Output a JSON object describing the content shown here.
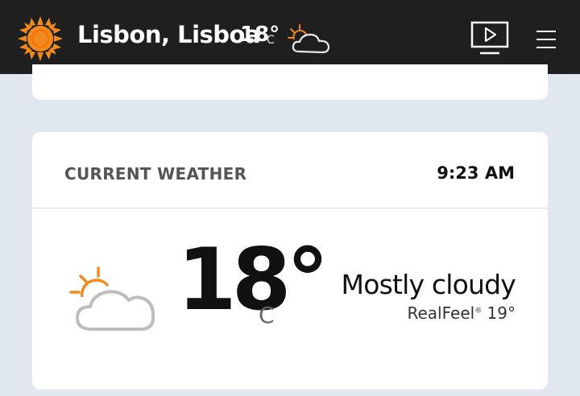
{
  "header": {
    "logo_icon": "sun-logo-icon",
    "location": "Lisbon, Lisboa",
    "temp": "18°",
    "unit": "C",
    "condition_icon": "partly-cloudy-icon",
    "video_icon": "video-play-icon",
    "menu_icon": "hamburger-menu-icon"
  },
  "current": {
    "title": "CURRENT WEATHER",
    "time": "9:23 AM",
    "condition_icon": "partly-cloudy-icon",
    "temp": "18°",
    "unit": "C",
    "phrase": "Mostly cloudy",
    "realfeel_label": "RealFeel",
    "realfeel_mark": "®",
    "realfeel_value": "19°"
  },
  "colors": {
    "topbar": "#1f1f1f",
    "page_bg": "#e1e7ef",
    "sun_orange": "#f08a1c",
    "cloud_gray": "#bdbdbd"
  }
}
